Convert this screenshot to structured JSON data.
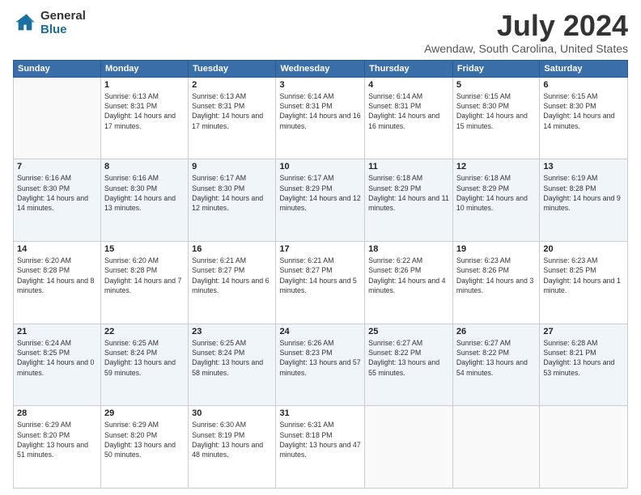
{
  "header": {
    "logo_general": "General",
    "logo_blue": "Blue",
    "title": "July 2024",
    "location": "Awendaw, South Carolina, United States"
  },
  "weekdays": [
    "Sunday",
    "Monday",
    "Tuesday",
    "Wednesday",
    "Thursday",
    "Friday",
    "Saturday"
  ],
  "weeks": [
    [
      {
        "day": "",
        "sunrise": "",
        "sunset": "",
        "daylight": ""
      },
      {
        "day": "1",
        "sunrise": "Sunrise: 6:13 AM",
        "sunset": "Sunset: 8:31 PM",
        "daylight": "Daylight: 14 hours and 17 minutes."
      },
      {
        "day": "2",
        "sunrise": "Sunrise: 6:13 AM",
        "sunset": "Sunset: 8:31 PM",
        "daylight": "Daylight: 14 hours and 17 minutes."
      },
      {
        "day": "3",
        "sunrise": "Sunrise: 6:14 AM",
        "sunset": "Sunset: 8:31 PM",
        "daylight": "Daylight: 14 hours and 16 minutes."
      },
      {
        "day": "4",
        "sunrise": "Sunrise: 6:14 AM",
        "sunset": "Sunset: 8:31 PM",
        "daylight": "Daylight: 14 hours and 16 minutes."
      },
      {
        "day": "5",
        "sunrise": "Sunrise: 6:15 AM",
        "sunset": "Sunset: 8:30 PM",
        "daylight": "Daylight: 14 hours and 15 minutes."
      },
      {
        "day": "6",
        "sunrise": "Sunrise: 6:15 AM",
        "sunset": "Sunset: 8:30 PM",
        "daylight": "Daylight: 14 hours and 14 minutes."
      }
    ],
    [
      {
        "day": "7",
        "sunrise": "Sunrise: 6:16 AM",
        "sunset": "Sunset: 8:30 PM",
        "daylight": "Daylight: 14 hours and 14 minutes."
      },
      {
        "day": "8",
        "sunrise": "Sunrise: 6:16 AM",
        "sunset": "Sunset: 8:30 PM",
        "daylight": "Daylight: 14 hours and 13 minutes."
      },
      {
        "day": "9",
        "sunrise": "Sunrise: 6:17 AM",
        "sunset": "Sunset: 8:30 PM",
        "daylight": "Daylight: 14 hours and 12 minutes."
      },
      {
        "day": "10",
        "sunrise": "Sunrise: 6:17 AM",
        "sunset": "Sunset: 8:29 PM",
        "daylight": "Daylight: 14 hours and 12 minutes."
      },
      {
        "day": "11",
        "sunrise": "Sunrise: 6:18 AM",
        "sunset": "Sunset: 8:29 PM",
        "daylight": "Daylight: 14 hours and 11 minutes."
      },
      {
        "day": "12",
        "sunrise": "Sunrise: 6:18 AM",
        "sunset": "Sunset: 8:29 PM",
        "daylight": "Daylight: 14 hours and 10 minutes."
      },
      {
        "day": "13",
        "sunrise": "Sunrise: 6:19 AM",
        "sunset": "Sunset: 8:28 PM",
        "daylight": "Daylight: 14 hours and 9 minutes."
      }
    ],
    [
      {
        "day": "14",
        "sunrise": "Sunrise: 6:20 AM",
        "sunset": "Sunset: 8:28 PM",
        "daylight": "Daylight: 14 hours and 8 minutes."
      },
      {
        "day": "15",
        "sunrise": "Sunrise: 6:20 AM",
        "sunset": "Sunset: 8:28 PM",
        "daylight": "Daylight: 14 hours and 7 minutes."
      },
      {
        "day": "16",
        "sunrise": "Sunrise: 6:21 AM",
        "sunset": "Sunset: 8:27 PM",
        "daylight": "Daylight: 14 hours and 6 minutes."
      },
      {
        "day": "17",
        "sunrise": "Sunrise: 6:21 AM",
        "sunset": "Sunset: 8:27 PM",
        "daylight": "Daylight: 14 hours and 5 minutes."
      },
      {
        "day": "18",
        "sunrise": "Sunrise: 6:22 AM",
        "sunset": "Sunset: 8:26 PM",
        "daylight": "Daylight: 14 hours and 4 minutes."
      },
      {
        "day": "19",
        "sunrise": "Sunrise: 6:23 AM",
        "sunset": "Sunset: 8:26 PM",
        "daylight": "Daylight: 14 hours and 3 minutes."
      },
      {
        "day": "20",
        "sunrise": "Sunrise: 6:23 AM",
        "sunset": "Sunset: 8:25 PM",
        "daylight": "Daylight: 14 hours and 1 minute."
      }
    ],
    [
      {
        "day": "21",
        "sunrise": "Sunrise: 6:24 AM",
        "sunset": "Sunset: 8:25 PM",
        "daylight": "Daylight: 14 hours and 0 minutes."
      },
      {
        "day": "22",
        "sunrise": "Sunrise: 6:25 AM",
        "sunset": "Sunset: 8:24 PM",
        "daylight": "Daylight: 13 hours and 59 minutes."
      },
      {
        "day": "23",
        "sunrise": "Sunrise: 6:25 AM",
        "sunset": "Sunset: 8:24 PM",
        "daylight": "Daylight: 13 hours and 58 minutes."
      },
      {
        "day": "24",
        "sunrise": "Sunrise: 6:26 AM",
        "sunset": "Sunset: 8:23 PM",
        "daylight": "Daylight: 13 hours and 57 minutes."
      },
      {
        "day": "25",
        "sunrise": "Sunrise: 6:27 AM",
        "sunset": "Sunset: 8:22 PM",
        "daylight": "Daylight: 13 hours and 55 minutes."
      },
      {
        "day": "26",
        "sunrise": "Sunrise: 6:27 AM",
        "sunset": "Sunset: 8:22 PM",
        "daylight": "Daylight: 13 hours and 54 minutes."
      },
      {
        "day": "27",
        "sunrise": "Sunrise: 6:28 AM",
        "sunset": "Sunset: 8:21 PM",
        "daylight": "Daylight: 13 hours and 53 minutes."
      }
    ],
    [
      {
        "day": "28",
        "sunrise": "Sunrise: 6:29 AM",
        "sunset": "Sunset: 8:20 PM",
        "daylight": "Daylight: 13 hours and 51 minutes."
      },
      {
        "day": "29",
        "sunrise": "Sunrise: 6:29 AM",
        "sunset": "Sunset: 8:20 PM",
        "daylight": "Daylight: 13 hours and 50 minutes."
      },
      {
        "day": "30",
        "sunrise": "Sunrise: 6:30 AM",
        "sunset": "Sunset: 8:19 PM",
        "daylight": "Daylight: 13 hours and 48 minutes."
      },
      {
        "day": "31",
        "sunrise": "Sunrise: 6:31 AM",
        "sunset": "Sunset: 8:18 PM",
        "daylight": "Daylight: 13 hours and 47 minutes."
      },
      {
        "day": "",
        "sunrise": "",
        "sunset": "",
        "daylight": ""
      },
      {
        "day": "",
        "sunrise": "",
        "sunset": "",
        "daylight": ""
      },
      {
        "day": "",
        "sunrise": "",
        "sunset": "",
        "daylight": ""
      }
    ]
  ]
}
